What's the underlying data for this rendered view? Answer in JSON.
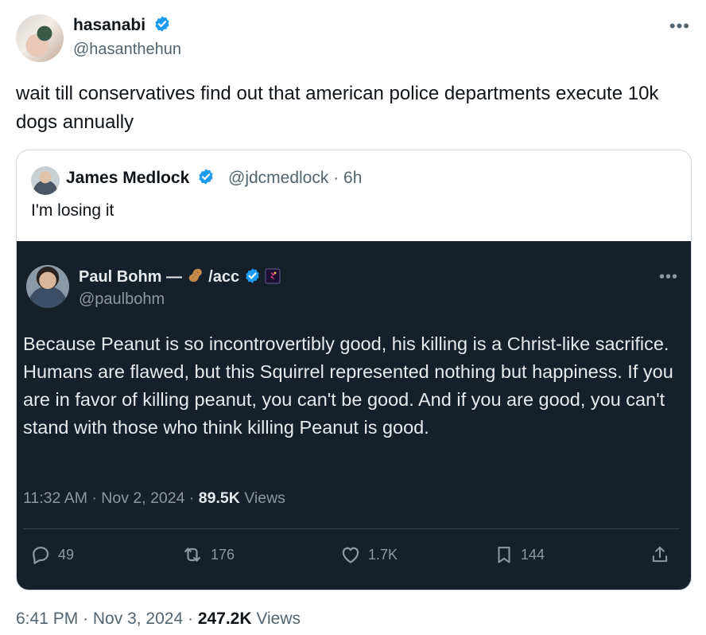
{
  "author": {
    "display_name": "hasanabi",
    "handle": "@hasanthehun"
  },
  "tweet": {
    "text": "wait till conservatives find out that american police departments execute 10k dogs annually",
    "time": "6:41 PM",
    "date": "Nov 3, 2024",
    "views_count": "247.2K",
    "views_label": "Views"
  },
  "quote": {
    "display_name": "James Medlock",
    "handle_time": "@jdcmedlock · 6h",
    "text": "I'm losing it"
  },
  "screenshot_tweet": {
    "display_name_prefix": "Paul Bohm —",
    "display_name_suffix": "/acc",
    "handle": "@paulbohm",
    "text": "Because Peanut is so incontrovertibly good, his killing is a Christ-like sacrifice. Humans are flawed, but this Squirrel represented nothing but happiness. If you are in favor of killing peanut, you can't be good. And if you are good, you can't stand with those who think killing Peanut is good.",
    "time": "11:32 AM",
    "date": "Nov 2, 2024",
    "views_count": "89.5K",
    "views_label": "Views",
    "actions": {
      "replies": "49",
      "reposts": "176",
      "likes": "1.7K",
      "bookmarks": "144"
    }
  },
  "icons": {
    "verified": "verified-badge-icon",
    "more": "more-icon",
    "reply": "reply-icon",
    "repost": "repost-icon",
    "like": "heart-icon",
    "bookmark": "bookmark-icon",
    "share": "share-icon"
  },
  "colors": {
    "verified_blue": "#1d9bf0",
    "dark_bg": "#15202b",
    "muted": "#536471"
  }
}
